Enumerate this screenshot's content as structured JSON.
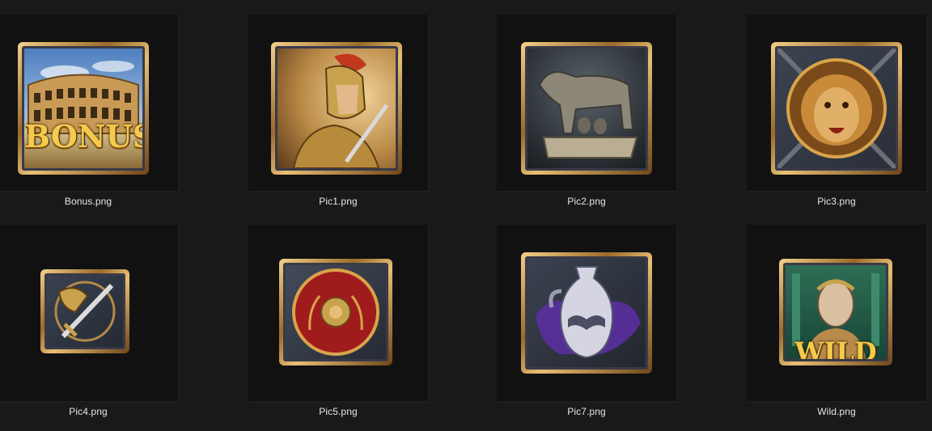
{
  "files": [
    {
      "name": "Bonus.png",
      "icon": "colosseum-bonus-icon",
      "overlay": "BONUS"
    },
    {
      "name": "Pic1.png",
      "icon": "roman-soldier-icon"
    },
    {
      "name": "Pic2.png",
      "icon": "she-wolf-icon"
    },
    {
      "name": "Pic3.png",
      "icon": "lion-icon"
    },
    {
      "name": "Pic4.png",
      "icon": "sword-helmet-icon"
    },
    {
      "name": "Pic5.png",
      "icon": "shield-icon"
    },
    {
      "name": "Pic7.png",
      "icon": "amphora-icon"
    },
    {
      "name": "Wild.png",
      "icon": "emperor-wild-icon",
      "overlay": "WILD"
    }
  ],
  "colors": {
    "background": "#191919",
    "cell": "#111111",
    "label": "#e6e6e6",
    "gold": "#f5c94a"
  }
}
